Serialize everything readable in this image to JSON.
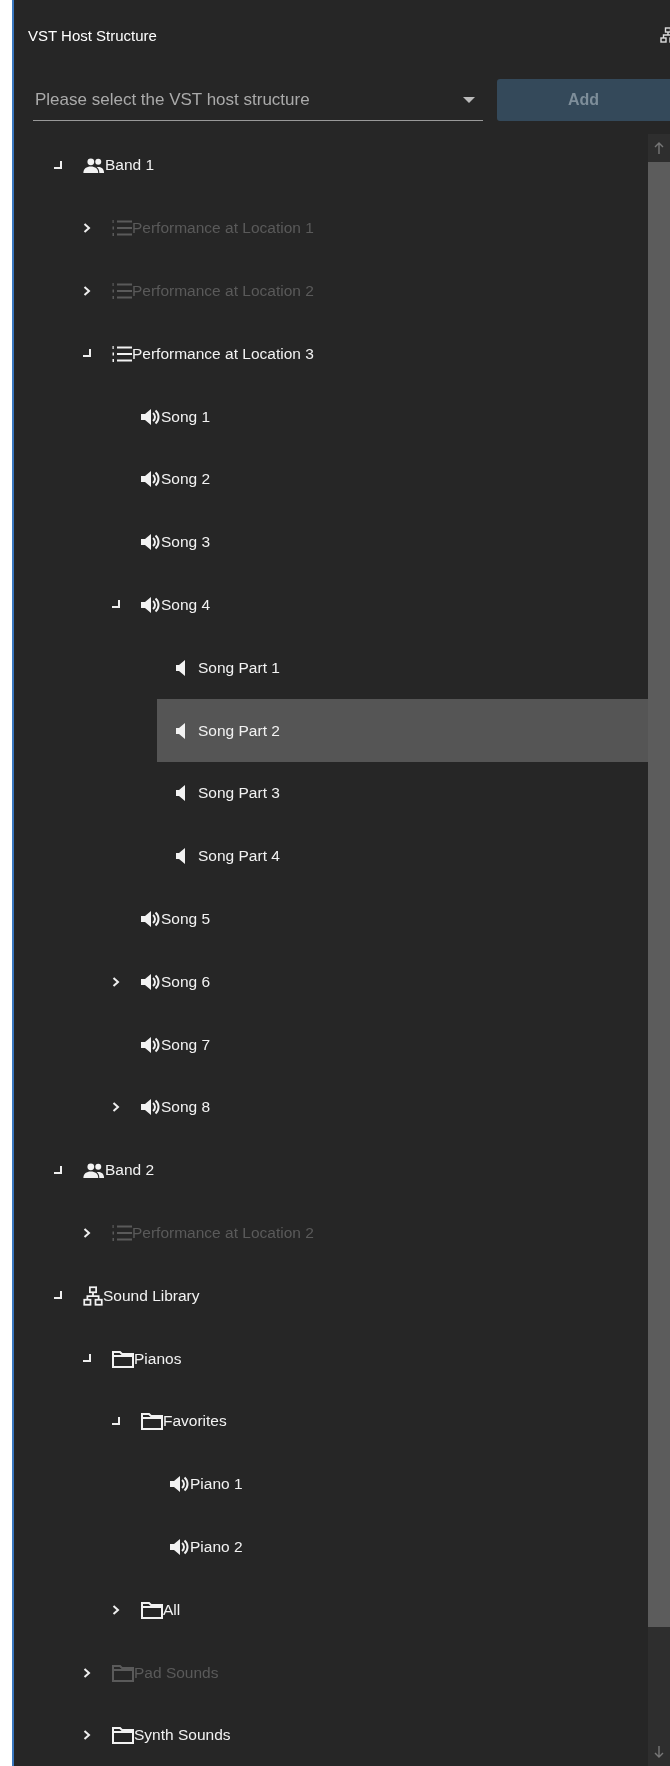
{
  "panel": {
    "title": "VST Host Structure"
  },
  "selector": {
    "placeholder": "Please select the VST host structure",
    "add_button": "Add",
    "add_disabled": true
  },
  "tree": [
    {
      "label": "Band 1",
      "kind": "group",
      "expanded": true,
      "disabled": false,
      "selected": false,
      "children": [
        {
          "label": "Performance at Location 1",
          "kind": "list",
          "expanded": false,
          "disabled": true,
          "selected": false
        },
        {
          "label": "Performance at Location 2",
          "kind": "list",
          "expanded": false,
          "disabled": true,
          "selected": false
        },
        {
          "label": "Performance at Location 3",
          "kind": "list",
          "expanded": true,
          "disabled": false,
          "selected": false,
          "children": [
            {
              "label": "Song 1",
              "kind": "song",
              "disabled": false,
              "selected": false
            },
            {
              "label": "Song 2",
              "kind": "song",
              "disabled": false,
              "selected": false
            },
            {
              "label": "Song 3",
              "kind": "song",
              "disabled": false,
              "selected": false
            },
            {
              "label": "Song 4",
              "kind": "song",
              "expanded": true,
              "disabled": false,
              "selected": false,
              "children": [
                {
                  "label": "Song Part 1",
                  "kind": "part",
                  "disabled": false,
                  "selected": false
                },
                {
                  "label": "Song Part 2",
                  "kind": "part",
                  "disabled": false,
                  "selected": true
                },
                {
                  "label": "Song Part 3",
                  "kind": "part",
                  "disabled": false,
                  "selected": false
                },
                {
                  "label": "Song Part 4",
                  "kind": "part",
                  "disabled": false,
                  "selected": false
                }
              ]
            },
            {
              "label": "Song 5",
              "kind": "song",
              "disabled": false,
              "selected": false
            },
            {
              "label": "Song 6",
              "kind": "song",
              "expanded": false,
              "disabled": false,
              "selected": false
            },
            {
              "label": "Song 7",
              "kind": "song",
              "disabled": false,
              "selected": false
            },
            {
              "label": "Song 8",
              "kind": "song",
              "expanded": false,
              "disabled": false,
              "selected": false
            }
          ]
        }
      ]
    },
    {
      "label": "Band 2",
      "kind": "group",
      "expanded": true,
      "disabled": false,
      "selected": false,
      "children": [
        {
          "label": "Performance at Location 2",
          "kind": "list",
          "expanded": false,
          "disabled": true,
          "selected": false
        }
      ]
    },
    {
      "label": "Sound Library",
      "kind": "library",
      "expanded": true,
      "disabled": false,
      "selected": false,
      "children": [
        {
          "label": "Pianos",
          "kind": "folder",
          "expanded": true,
          "disabled": false,
          "selected": false,
          "children": [
            {
              "label": "Favorites",
              "kind": "folder",
              "expanded": true,
              "disabled": false,
              "selected": false,
              "children": [
                {
                  "label": "Piano 1",
                  "kind": "song",
                  "disabled": false,
                  "selected": false
                },
                {
                  "label": "Piano 2",
                  "kind": "song",
                  "disabled": false,
                  "selected": false
                }
              ]
            },
            {
              "label": "All",
              "kind": "folder",
              "expanded": false,
              "disabled": false,
              "selected": false
            }
          ]
        },
        {
          "label": "Pad Sounds",
          "kind": "folder",
          "expanded": false,
          "disabled": true,
          "selected": false
        },
        {
          "label": "Synth Sounds",
          "kind": "folder",
          "expanded": false,
          "disabled": false,
          "selected": false
        }
      ]
    }
  ]
}
